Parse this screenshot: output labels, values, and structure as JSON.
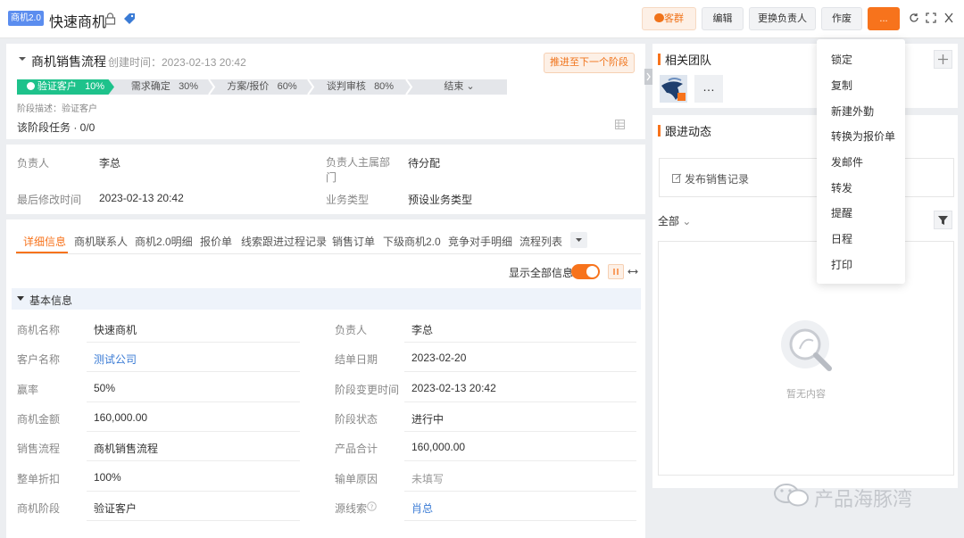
{
  "header": {
    "badge": "商机2.0",
    "title": "快速商机",
    "buttons": {
      "chat": "客群",
      "edit": "编辑",
      "change_owner": "更换负责人",
      "void": "作废",
      "more": "..."
    }
  },
  "process": {
    "name": "商机销售流程",
    "created": "创建时间：2023-02-13 20:42",
    "advance_btn": "推进至下一个阶段",
    "stages": [
      {
        "label": "验证客户",
        "pct": "10%"
      },
      {
        "label": "需求确定",
        "pct": "30%"
      },
      {
        "label": "方案/报价",
        "pct": "60%"
      },
      {
        "label": "谈判审核",
        "pct": "80%"
      },
      {
        "label": "结束",
        "pct": ""
      }
    ],
    "stage_desc": "阶段描述：验证客户",
    "stage_task": "该阶段任务 · 0/0"
  },
  "summary": {
    "owner_label": "负责人",
    "owner": "李总",
    "dept_label": "负责人主属部门",
    "dept": "待分配",
    "modified_label": "最后修改时间",
    "modified": "2023-02-13 20:42",
    "biz_label": "业务类型",
    "biz": "预设业务类型"
  },
  "tabs": [
    "详细信息",
    "商机联系人",
    "商机2.0明细",
    "报价单",
    "线索跟进过程记录",
    "销售订单",
    "下级商机2.0",
    "竞争对手明细",
    "流程列表"
  ],
  "toggle_label": "显示全部信息",
  "section_title": "基本信息",
  "fields_left": [
    {
      "label": "商机名称",
      "value": "快速商机"
    },
    {
      "label": "客户名称",
      "value": "测试公司"
    },
    {
      "label": "赢率",
      "value": "50%"
    },
    {
      "label": "商机金额",
      "value": "160,000.00"
    },
    {
      "label": "销售流程",
      "value": "商机销售流程"
    },
    {
      "label": "整单折扣",
      "value": "100%"
    },
    {
      "label": "商机阶段",
      "value": "验证客户"
    }
  ],
  "fields_right": [
    {
      "label": "负责人",
      "value": "李总"
    },
    {
      "label": "结单日期",
      "value": "2023-02-20"
    },
    {
      "label": "阶段变更时间",
      "value": "2023-02-13 20:42"
    },
    {
      "label": "阶段状态",
      "value": "进行中"
    },
    {
      "label": "产品合计",
      "value": "160,000.00"
    },
    {
      "label": "输单原因",
      "value": "未填写"
    },
    {
      "label": "源线索",
      "value": "肖总"
    }
  ],
  "team": {
    "title": "相关团队"
  },
  "activity": {
    "title": "跟进动态",
    "publish": "发布销售记录",
    "filter": "全部",
    "empty": "暂无内容"
  },
  "menu": [
    "锁定",
    "复制",
    "新建外勤",
    "转换为报价单",
    "发邮件",
    "转发",
    "提醒",
    "日程",
    "打印"
  ],
  "watermark": "产品海豚湾",
  "colors": {
    "accent": "#f7731c",
    "stage_active": "#1ec28b",
    "link": "#3a7bd5"
  }
}
